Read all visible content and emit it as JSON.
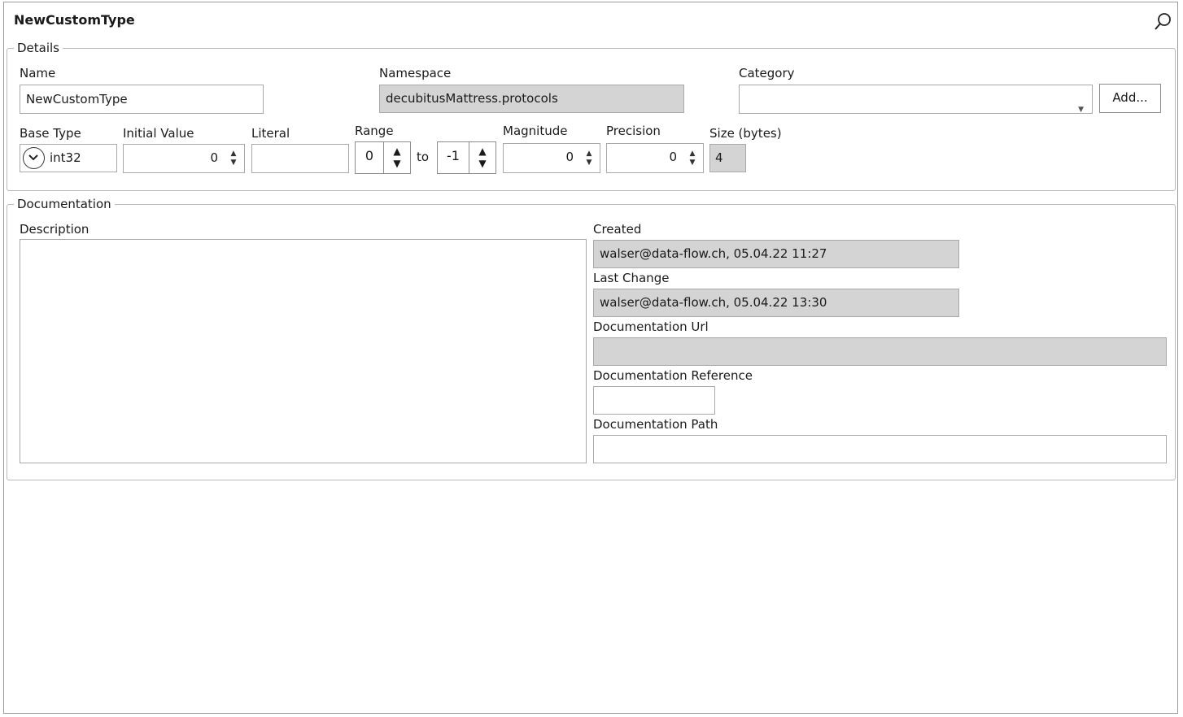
{
  "window": {
    "title": "NewCustomType",
    "search_icon": "search-icon"
  },
  "details": {
    "legend": "Details",
    "name": {
      "label": "Name",
      "value": "NewCustomType"
    },
    "namespace": {
      "label": "Namespace",
      "value": "decubitusMattress.protocols"
    },
    "category": {
      "label": "Category",
      "value": "",
      "add_label": "Add..."
    },
    "base_type": {
      "label": "Base Type",
      "value": "int32",
      "icon": "chevron-down-circle-icon"
    },
    "initial_value": {
      "label": "Initial Value",
      "value": "0"
    },
    "literal": {
      "label": "Literal",
      "value": ""
    },
    "range": {
      "label": "Range",
      "from": "0",
      "separator": "to",
      "to": "-1"
    },
    "magnitude": {
      "label": "Magnitude",
      "value": "0"
    },
    "precision": {
      "label": "Precision",
      "value": "0"
    },
    "size": {
      "label": "Size (bytes)",
      "value": "4"
    }
  },
  "documentation": {
    "legend": "Documentation",
    "description": {
      "label": "Description",
      "value": ""
    },
    "created": {
      "label": "Created",
      "value": "walser@data-flow.ch, 05.04.22 11:27"
    },
    "last_change": {
      "label": "Last Change",
      "value": "walser@data-flow.ch, 05.04.22 13:30"
    },
    "doc_url": {
      "label": "Documentation Url",
      "value": ""
    },
    "doc_reference": {
      "label": "Documentation Reference",
      "value": ""
    },
    "doc_path": {
      "label": "Documentation Path",
      "value": ""
    }
  }
}
